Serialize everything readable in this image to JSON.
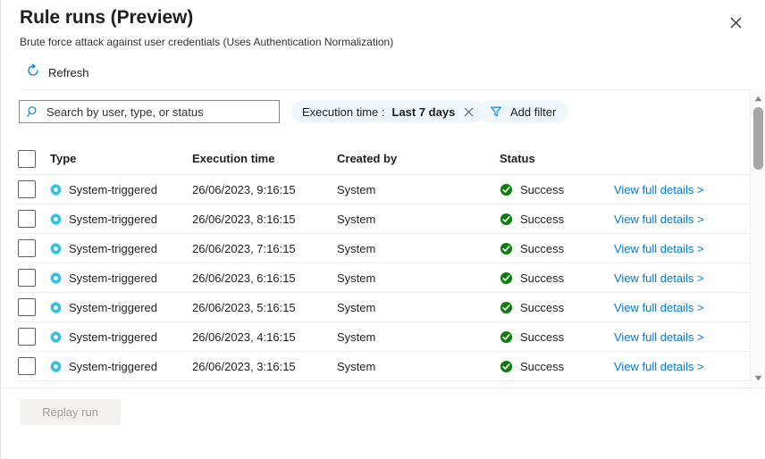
{
  "header": {
    "title": "Rule runs (Preview)",
    "subtitle": "Brute force attack against user credentials (Uses Authentication Normalization)",
    "close_icon": "close-icon"
  },
  "toolbar": {
    "refresh_label": "Refresh",
    "refresh_icon": "refresh-icon"
  },
  "search": {
    "placeholder": "Search by user, type, or status",
    "value": "",
    "icon": "search-icon"
  },
  "filters": {
    "execution_time": {
      "key": "Execution time : ",
      "value": "Last 7 days",
      "remove_icon": "close-icon"
    },
    "add_filter_label": "Add filter",
    "add_filter_icon": "filter-icon"
  },
  "table": {
    "columns": [
      "Type",
      "Execution time",
      "Created by",
      "Status"
    ],
    "rows": [
      {
        "type": "System-triggered",
        "time": "26/06/2023, 9:16:15",
        "created_by": "System",
        "status": "Success",
        "action": "View full details >"
      },
      {
        "type": "System-triggered",
        "time": "26/06/2023, 8:16:15",
        "created_by": "System",
        "status": "Success",
        "action": "View full details >"
      },
      {
        "type": "System-triggered",
        "time": "26/06/2023, 7:16:15",
        "created_by": "System",
        "status": "Success",
        "action": "View full details >"
      },
      {
        "type": "System-triggered",
        "time": "26/06/2023, 6:16:15",
        "created_by": "System",
        "status": "Success",
        "action": "View full details >"
      },
      {
        "type": "System-triggered",
        "time": "26/06/2023, 5:16:15",
        "created_by": "System",
        "status": "Success",
        "action": "View full details >"
      },
      {
        "type": "System-triggered",
        "time": "26/06/2023, 4:16:15",
        "created_by": "System",
        "status": "Success",
        "action": "View full details >"
      },
      {
        "type": "System-triggered",
        "time": "26/06/2023, 3:16:15",
        "created_by": "System",
        "status": "Success",
        "action": "View full details >"
      }
    ]
  },
  "footer": {
    "replay_label": "Replay run"
  },
  "colors": {
    "accent_link": "#0078d4",
    "gear_icon": "#32bedd",
    "success_green": "#107c10",
    "pill_background": "#eff6fc",
    "disabled_button_bg": "#f3f2f1",
    "disabled_button_text": "#a19f9d"
  }
}
